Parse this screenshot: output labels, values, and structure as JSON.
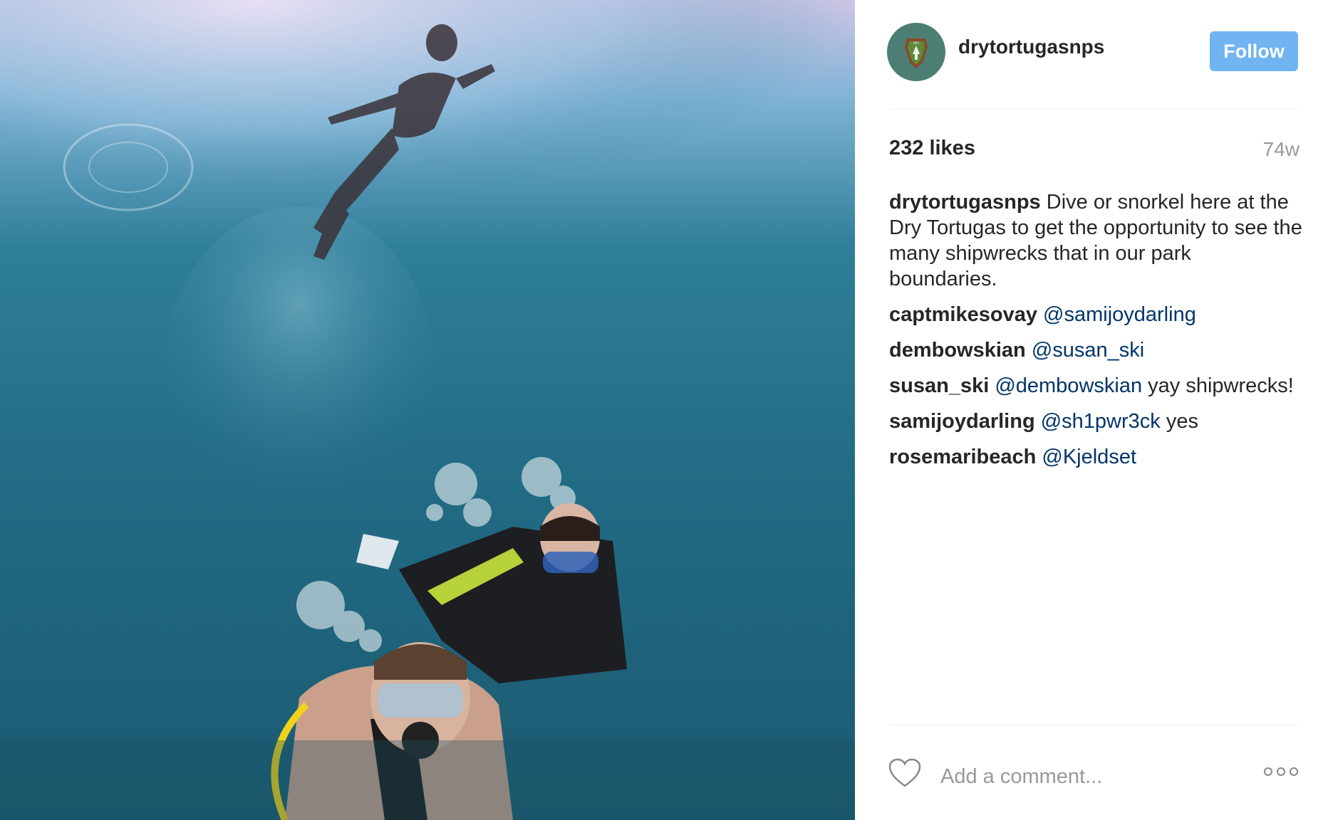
{
  "post": {
    "username": "drytortugasnps",
    "follow_label": "Follow",
    "likes": "232 likes",
    "time": "74w",
    "caption": {
      "user": "drytortugasnps",
      "text": " Dive or snorkel here at the Dry Tortugas to get the opportunity to see the many shipwrecks that in our park boundaries."
    },
    "comments": [
      {
        "user": "captmikesovay",
        "mention": "@samijoydarling",
        "text": ""
      },
      {
        "user": "dembowskian",
        "mention": "@susan_ski",
        "text": ""
      },
      {
        "user": "susan_ski",
        "mention": "@dembowskian",
        "text": " yay shipwrecks!"
      },
      {
        "user": "samijoydarling",
        "mention": "@sh1pwr3ck",
        "text": " yes"
      },
      {
        "user": "rosemaribeach",
        "mention": "@Kjeldset",
        "text": ""
      }
    ],
    "comment_placeholder": "Add a comment..."
  },
  "icons": {
    "avatar": "nps-arrowhead-logo",
    "like": "heart-icon",
    "more": "more-options-icon"
  },
  "colors": {
    "follow_button": "#70b4f1",
    "mention": "#003569",
    "muted": "#999999",
    "avatar_bg": "#4d7e74"
  }
}
